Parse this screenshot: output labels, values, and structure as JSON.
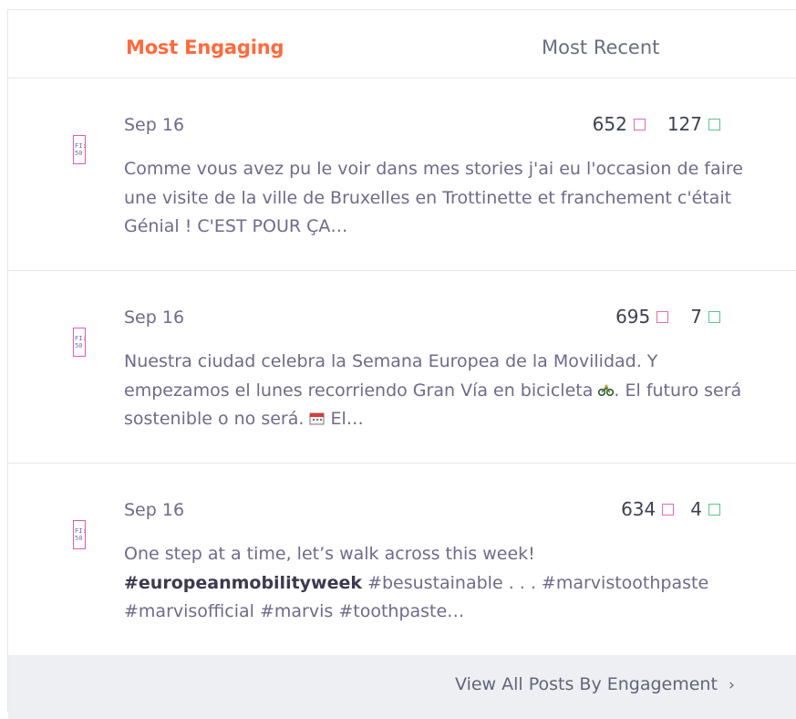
{
  "tabs": {
    "active_label": "Most Engaging",
    "other_label": "Most Recent"
  },
  "posts": [
    {
      "thumb_text": "FI:\n50",
      "date": "Sep 16",
      "engagements": "652",
      "comments": "127",
      "text": "Comme vous avez pu le voir dans mes stories j'ai eu l'occasion de faire une visite de la ville de Bruxelles en Trottinette et franchement c'était Génial ! C'EST POUR ÇA…"
    },
    {
      "thumb_text": "FI:\n50",
      "date": "Sep 16",
      "engagements": "695",
      "comments": "7",
      "text_a": "Nuestra ciudad celebra la Semana Europea de la Movilidad. Y empezamos el lunes recorriendo Gran Vía en bicicleta ",
      "text_b": ". El futuro será sostenible o no será. ",
      "text_c": " El…"
    },
    {
      "thumb_text": "FI:\n50",
      "date": "Sep 16",
      "engagements": "634",
      "comments": "4",
      "text_a": "One step at a time, let’s walk across this week!",
      "hashtag_bold": "#europeanmobilityweek",
      "text_b": " #besustainable . . . #marvistoothpaste #marvisofficial #marvis #toothpaste…"
    }
  ],
  "footer": {
    "link_label": "View All Posts By Engagement",
    "chevron": "›"
  },
  "colors": {
    "accent": "#ff6a3d",
    "engagement_icon": "#e36ab8",
    "comment_icon": "#5ac88a",
    "footer_bg": "#eeeff3"
  },
  "icons": {
    "engagement": "square-outline-pink-icon",
    "comment": "square-outline-green-icon",
    "bicycle": "bicycle-emoji-icon",
    "calendar": "calendar-emoji-icon"
  }
}
